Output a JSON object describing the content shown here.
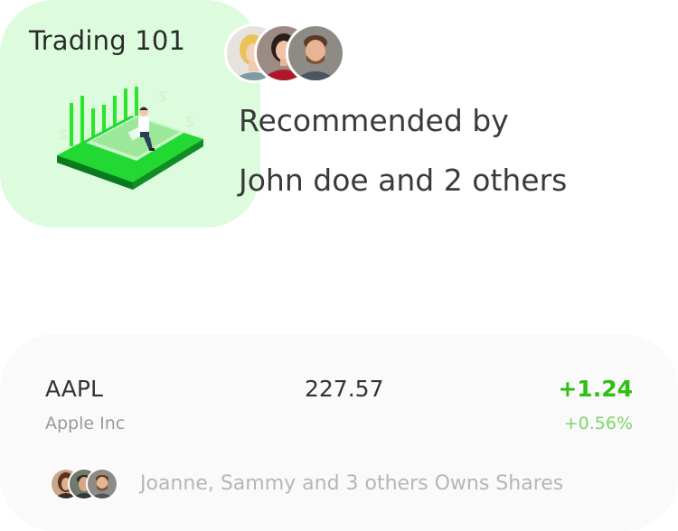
{
  "course": {
    "title": "Trading 101",
    "recommended_line1": "Recommended by",
    "recommended_line2": "John doe and 2 others",
    "avatars": [
      "woman-blonde-avatar",
      "woman-red-avatar",
      "man-beard-avatar"
    ]
  },
  "stock": {
    "ticker": "AAPL",
    "company": "Apple Inc",
    "price": "227.57",
    "change": "+1.24",
    "change_percent": "+0.56%",
    "owners_text": "Joanne, Sammy and 3 others Owns Shares",
    "owner_avatars": [
      "woman-avatar",
      "man-avatar",
      "man-beard-avatar"
    ]
  },
  "colors": {
    "course_card_bg": "#ddfcde",
    "stock_card_bg": "#fafafa",
    "positive": "#2ec012",
    "positive_light": "#7fd46a",
    "illustration_green": "#1ed91e"
  }
}
